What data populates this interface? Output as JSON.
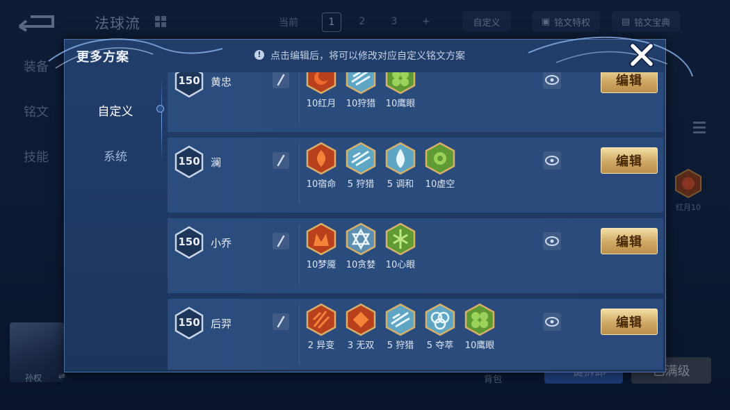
{
  "background": {
    "plan_title": "法球流",
    "current_label": "当前",
    "pages": [
      "1",
      "2",
      "3",
      "+"
    ],
    "custom_button": "自定义",
    "privilege_button": "铭文特权",
    "codex_button": "铭文宝典",
    "side_tabs": [
      "装备",
      "铭文",
      "技能"
    ],
    "right_badge_label": "红月10",
    "avatar_name": "孙权",
    "swap_icon": "⇌",
    "bottom_text": "背包",
    "bottom_btn1": "一键拆卸",
    "bottom_btn2": "已满级"
  },
  "dialog": {
    "title": "更多方案",
    "notice": "点击编辑后，将可以修改对应自定义铭文方案",
    "notice_icon": "!",
    "tabs": [
      {
        "label": "自定义",
        "active": true
      },
      {
        "label": "系统",
        "active": false
      }
    ],
    "edit_label": "编辑",
    "presets": [
      {
        "level": "150",
        "hero": "黄忠",
        "inscriptions": [
          {
            "label": "10红月",
            "color": "red"
          },
          {
            "label": "10狩猎",
            "color": "blue"
          },
          {
            "label": "10鹰眼",
            "color": "green"
          }
        ]
      },
      {
        "level": "150",
        "hero": "澜",
        "inscriptions": [
          {
            "label": "10宿命",
            "color": "red"
          },
          {
            "label": "5 狩猎",
            "color": "blue"
          },
          {
            "label": "5 调和",
            "color": "blue"
          },
          {
            "label": "10虚空",
            "color": "green"
          }
        ]
      },
      {
        "level": "150",
        "hero": "小乔",
        "inscriptions": [
          {
            "label": "10梦魇",
            "color": "red"
          },
          {
            "label": "10贪婪",
            "color": "blue"
          },
          {
            "label": "10心眼",
            "color": "green"
          }
        ]
      },
      {
        "level": "150",
        "hero": "后羿",
        "inscriptions": [
          {
            "label": "2 异变",
            "color": "red"
          },
          {
            "label": "3 无双",
            "color": "red"
          },
          {
            "label": "5 狩猎",
            "color": "blue"
          },
          {
            "label": "5 夺萃",
            "color": "blue"
          },
          {
            "label": "10鹰眼",
            "color": "green"
          }
        ]
      }
    ]
  },
  "colors": {
    "red": "#c2401f",
    "blue": "#5fa6c4",
    "green": "#5f9a34",
    "gold": "#cfa863"
  }
}
